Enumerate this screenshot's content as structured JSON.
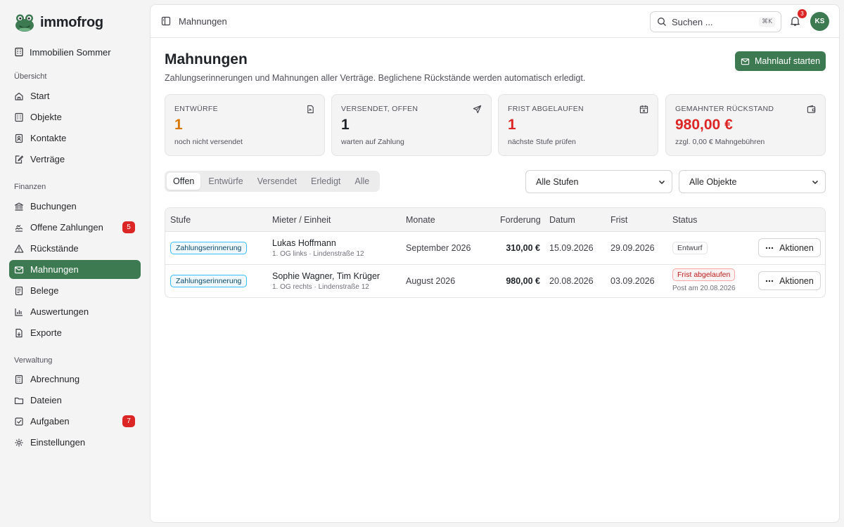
{
  "app": {
    "name": "immofrog"
  },
  "org": {
    "name": "Immobilien Sommer"
  },
  "sidebar": {
    "section_overview": "Übersicht",
    "section_finance": "Finanzen",
    "section_admin": "Verwaltung",
    "overview": [
      {
        "label": "Start",
        "icon": "home-icon"
      },
      {
        "label": "Objekte",
        "icon": "building-icon"
      },
      {
        "label": "Kontakte",
        "icon": "contacts-icon"
      },
      {
        "label": "Verträge",
        "icon": "contract-icon"
      }
    ],
    "finance": [
      {
        "label": "Buchungen",
        "icon": "bank-icon"
      },
      {
        "label": "Offene Zahlungen",
        "icon": "payment-icon",
        "badge": "5"
      },
      {
        "label": "Rückstände",
        "icon": "warning-icon"
      },
      {
        "label": "Mahnungen",
        "icon": "mail-icon",
        "active": true
      },
      {
        "label": "Belege",
        "icon": "receipt-icon"
      },
      {
        "label": "Auswertungen",
        "icon": "chart-icon"
      },
      {
        "label": "Exporte",
        "icon": "export-icon"
      }
    ],
    "admin": [
      {
        "label": "Abrechnung",
        "icon": "calculator-icon"
      },
      {
        "label": "Dateien",
        "icon": "folder-icon"
      },
      {
        "label": "Aufgaben",
        "icon": "task-icon",
        "badge": "7"
      },
      {
        "label": "Einstellungen",
        "icon": "gear-icon"
      }
    ]
  },
  "topbar": {
    "breadcrumb": "Mahnungen",
    "search_placeholder": "Suchen ...",
    "search_shortcut": "⌘K",
    "notifications_count": "3",
    "avatar_initials": "KS"
  },
  "page": {
    "title": "Mahnungen",
    "subtitle": "Zahlungserinnerungen und Mahnungen aller Verträge. Beglichene Rückstände werden automatisch erledigt.",
    "primary_action": "Mahnlauf starten"
  },
  "stats": [
    {
      "label": "ENTWÜRFE",
      "value": "1",
      "sub": "noch nicht versendet",
      "color": "#d97706",
      "icon": "document-icon"
    },
    {
      "label": "VERSENDET, OFFEN",
      "value": "1",
      "sub": "warten auf Zahlung",
      "color": "#1f2328",
      "icon": "send-icon"
    },
    {
      "label": "FRIST ABGELAUFEN",
      "value": "1",
      "sub": "nächste Stufe prüfen",
      "color": "#dc2626",
      "icon": "calendar-icon"
    },
    {
      "label": "GEMAHNTER RÜCKSTAND",
      "value": "980,00 €",
      "sub": "zzgl. 0,00 € Mahngebühren",
      "color": "#dc2626",
      "icon": "wallet-icon"
    }
  ],
  "tabs": [
    "Offen",
    "Entwürfe",
    "Versendet",
    "Erledigt",
    "Alle"
  ],
  "active_tab": "Offen",
  "filters": {
    "stage": "Alle Stufen",
    "property": "Alle Objekte"
  },
  "table": {
    "columns": [
      "Stufe",
      "Mieter / Einheit",
      "Monate",
      "Forderung",
      "Datum",
      "Frist",
      "Status"
    ],
    "rows": [
      {
        "stage": "Zahlungserinnerung",
        "tenant": "Lukas Hoffmann",
        "unit": "1. OG links · Lindenstraße 12",
        "months": "September 2026",
        "amount": "310,00 €",
        "date": "15.09.2026",
        "deadline": "29.09.2026",
        "status": "Entwurf",
        "status_note": "",
        "action": "Aktionen"
      },
      {
        "stage": "Zahlungserinnerung",
        "tenant": "Sophie Wagner, Tim Krüger",
        "unit": "1. OG rechts · Lindenstraße 12",
        "months": "August 2026",
        "amount": "980,00 €",
        "date": "20.08.2026",
        "deadline": "03.09.2026",
        "status": "Frist abgelaufen",
        "status_note": "Post am 20.08.2026",
        "action": "Aktionen"
      }
    ]
  },
  "colors": {
    "brand": "#3d7a52",
    "danger": "#dc2626",
    "warning": "#d97706"
  }
}
